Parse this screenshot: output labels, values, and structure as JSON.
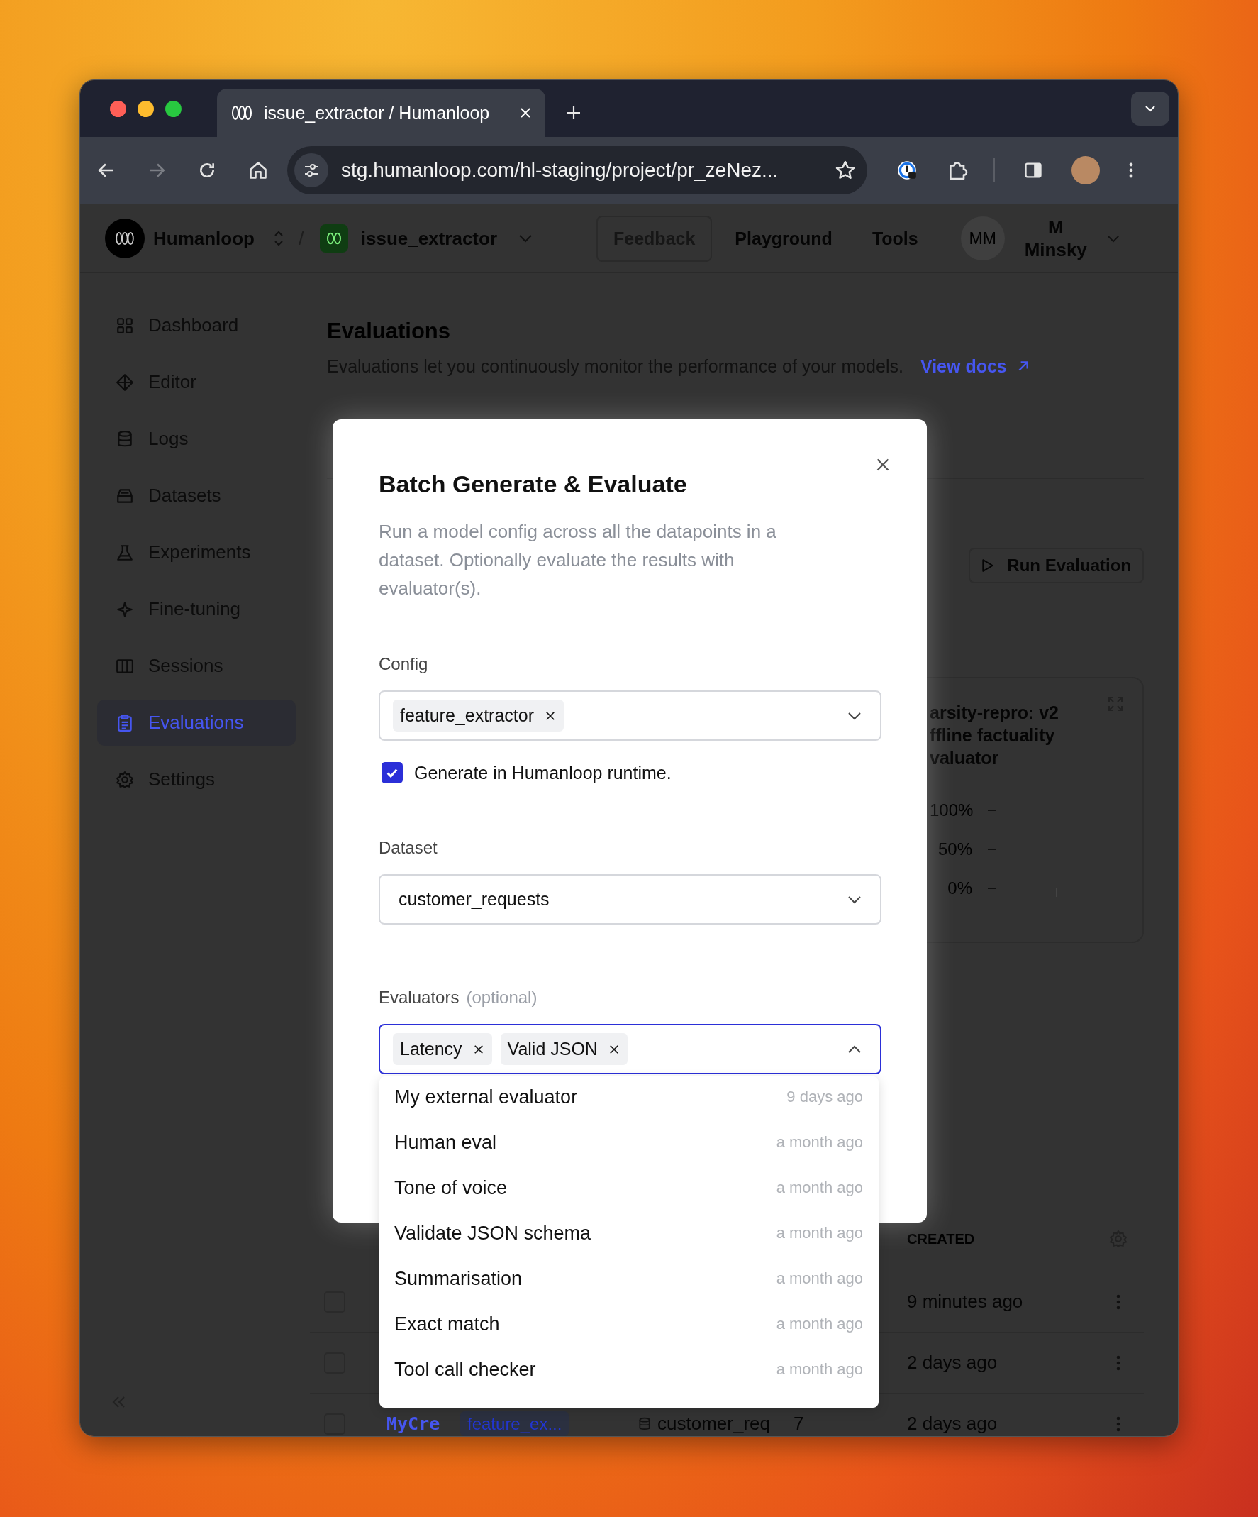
{
  "browser": {
    "tab_title": "issue_extractor / Humanloop",
    "url": "stg.humanloop.com/hl-staging/project/pr_zeNez..."
  },
  "header": {
    "org": "Humanloop",
    "separator": "/",
    "project": "issue_extractor",
    "nav": [
      {
        "label": "Feedback",
        "kind": "outlined"
      },
      {
        "label": "Playground",
        "kind": "plain"
      },
      {
        "label": "Tools",
        "kind": "plain"
      }
    ],
    "avatar_initials": "MM",
    "user_name_lines": [
      "M",
      "Minsky"
    ]
  },
  "sidebar": {
    "items": [
      {
        "label": "Dashboard",
        "kind": "grid",
        "selected": false
      },
      {
        "label": "Editor",
        "kind": "diamond",
        "selected": false
      },
      {
        "label": "Logs",
        "kind": "database",
        "selected": false
      },
      {
        "label": "Datasets",
        "kind": "tray",
        "selected": false
      },
      {
        "label": "Experiments",
        "kind": "flask",
        "selected": false
      },
      {
        "label": "Fine-tuning",
        "kind": "sparkle",
        "selected": false
      },
      {
        "label": "Sessions",
        "kind": "columns",
        "selected": false
      },
      {
        "label": "Evaluations",
        "kind": "clipboard",
        "selected": true
      },
      {
        "label": "Settings",
        "kind": "gear",
        "selected": false
      }
    ]
  },
  "page": {
    "title": "Evaluations",
    "description": "Evaluations let you continuously monitor the performance of your models.",
    "docs_link": "View docs",
    "run_button": "Run Evaluation"
  },
  "chart_card": {
    "title_lines": [
      "arsity-repro: v2",
      "ffline factuality",
      "valuator"
    ],
    "y_tick_labels": [
      "100%",
      "50%",
      "0%"
    ]
  },
  "table": {
    "columns": [
      "CREATED"
    ],
    "rows": [
      {
        "checked": false,
        "created": "9 minutes ago"
      },
      {
        "checked": false,
        "created": "2 days ago"
      },
      {
        "checked": false,
        "name": "MyCre",
        "config": "feature_ex...",
        "dataset": "customer_req",
        "count": "7",
        "created": "2 days ago"
      }
    ]
  },
  "modal": {
    "title": "Batch Generate & Evaluate",
    "description": "Run a model config across all the datapoints in a dataset. Optionally evaluate the results with evaluator(s).",
    "config": {
      "label": "Config",
      "chips": [
        "feature_extractor"
      ]
    },
    "runtime_checkbox": {
      "label": "Generate in Humanloop runtime.",
      "checked": true
    },
    "dataset": {
      "label": "Dataset",
      "value": "customer_requests"
    },
    "evaluators": {
      "label": "Evaluators",
      "hint": "(optional)",
      "chips": [
        "Latency",
        "Valid JSON"
      ],
      "expanded": true,
      "options": [
        {
          "name": "My external evaluator",
          "time": "9 days ago"
        },
        {
          "name": "Human eval",
          "time": "a month ago"
        },
        {
          "name": "Tone of voice",
          "time": "a month ago"
        },
        {
          "name": "Validate JSON schema",
          "time": "a month ago"
        },
        {
          "name": "Summarisation",
          "time": "a month ago"
        },
        {
          "name": "Exact match",
          "time": "a month ago"
        },
        {
          "name": "Tool call checker",
          "time": "a month ago"
        }
      ]
    }
  }
}
